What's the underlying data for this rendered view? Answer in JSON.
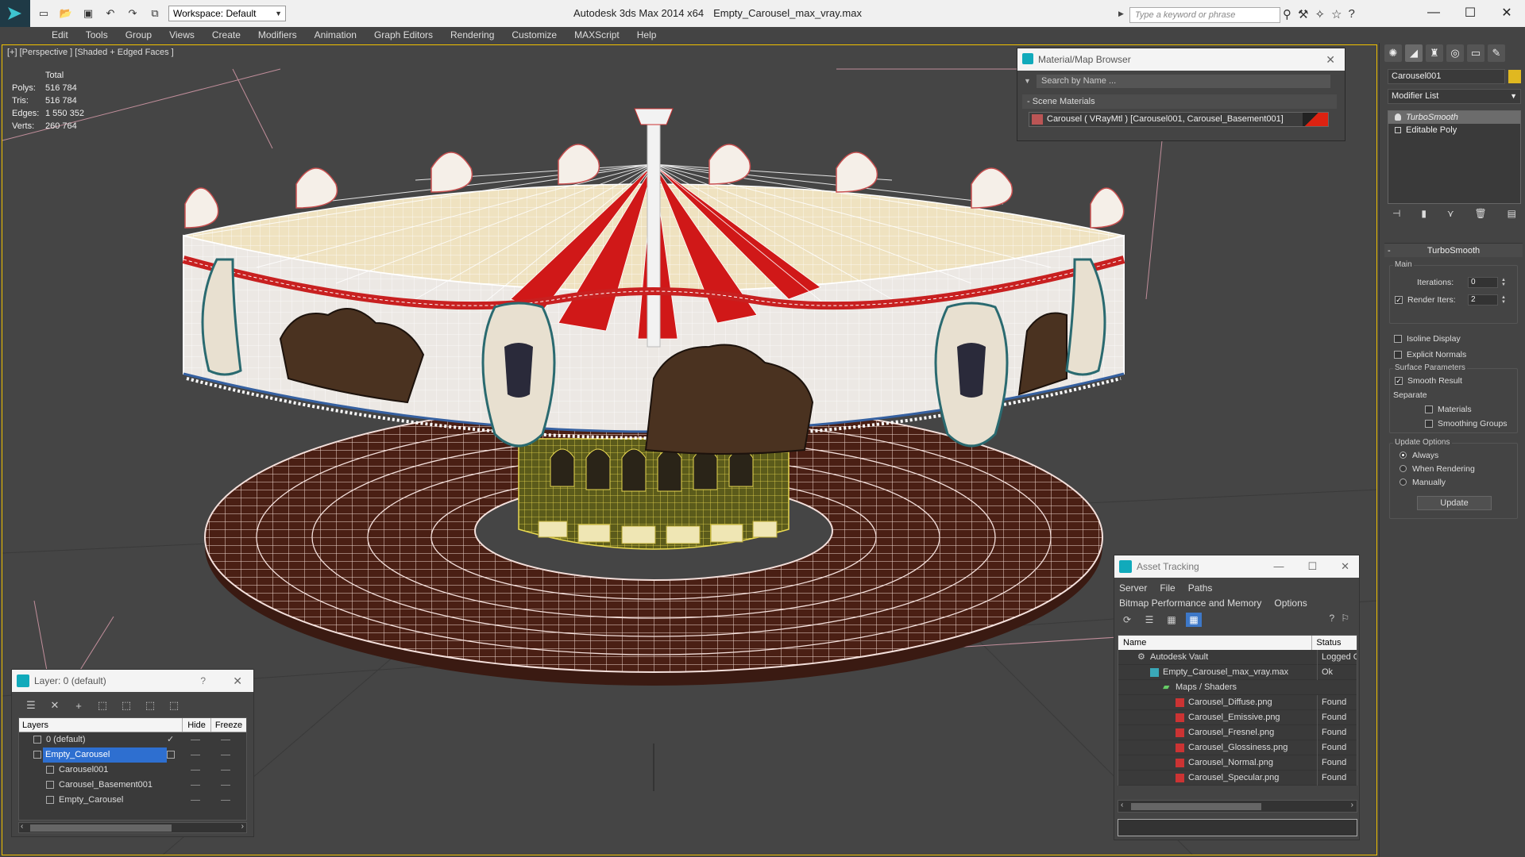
{
  "app": {
    "title": "Autodesk 3ds Max  2014 x64",
    "file": "Empty_Carousel_max_vray.max",
    "workspace": "Workspace: Default",
    "search_placeholder": "Type a keyword or phrase"
  },
  "menu": [
    "Edit",
    "Tools",
    "Group",
    "Views",
    "Create",
    "Modifiers",
    "Animation",
    "Graph Editors",
    "Rendering",
    "Customize",
    "MAXScript",
    "Help"
  ],
  "viewport": {
    "label": "[+] [Perspective ] [Shaded + Edged Faces ]",
    "stats": {
      "header": "Total",
      "rows": [
        {
          "label": "Polys:",
          "value": "516 784"
        },
        {
          "label": "Tris:",
          "value": "516 784"
        },
        {
          "label": "Edges:",
          "value": "1 550 352"
        },
        {
          "label": "Verts:",
          "value": "260 764"
        }
      ]
    }
  },
  "material_browser": {
    "title": "Material/Map Browser",
    "search": "Search by Name ...",
    "group": "- Scene Materials",
    "entry": "Carousel  ( VRayMtl )  [Carousel001, Carousel_Basement001]"
  },
  "command_panel": {
    "object_name": "Carousel001",
    "modifier_list": "Modifier List",
    "stack": [
      "TurboSmooth",
      "Editable Poly"
    ],
    "rollout": "TurboSmooth",
    "main_group": "Main",
    "iterations_label": "Iterations:",
    "iterations_value": "0",
    "render_iters_label": "Render Iters:",
    "render_iters_value": "2",
    "isoline": "Isoline Display",
    "explicit_normals": "Explicit Normals",
    "surface_group": "Surface Parameters",
    "smooth_result": "Smooth Result",
    "separate": "Separate",
    "materials": "Materials",
    "smoothing_groups": "Smoothing Groups",
    "update_group": "Update Options",
    "always": "Always",
    "when_rendering": "When Rendering",
    "manually": "Manually",
    "update_button": "Update"
  },
  "layer_manager": {
    "title": "Layer: 0 (default)",
    "help": "?",
    "col_layers": "Layers",
    "col_hide": "Hide",
    "col_freeze": "Freeze",
    "rows": [
      "0 (default)",
      "Empty_Carousel",
      "Carousel001",
      "Carousel_Basement001",
      "Empty_Carousel"
    ]
  },
  "asset_tracking": {
    "title": "Asset Tracking",
    "menus1": [
      "Server",
      "File",
      "Paths"
    ],
    "menus2": [
      "Bitmap Performance and Memory",
      "Options"
    ],
    "col_name": "Name",
    "col_status": "Status",
    "rows": [
      {
        "name": "Autodesk Vault",
        "status": "Logged Out"
      },
      {
        "name": "Empty_Carousel_max_vray.max",
        "status": "Ok"
      },
      {
        "name": "Maps / Shaders",
        "status": ""
      },
      {
        "name": "Carousel_Diffuse.png",
        "status": "Found"
      },
      {
        "name": "Carousel_Emissive.png",
        "status": "Found"
      },
      {
        "name": "Carousel_Fresnel.png",
        "status": "Found"
      },
      {
        "name": "Carousel_Glossiness.png",
        "status": "Found"
      },
      {
        "name": "Carousel_Normal.png",
        "status": "Found"
      },
      {
        "name": "Carousel_Specular.png",
        "status": "Found"
      }
    ]
  },
  "colors": {
    "accent_blue": "#2e6fd0",
    "viewport_border": "#f0c000",
    "wire_white": "#ffffff"
  }
}
